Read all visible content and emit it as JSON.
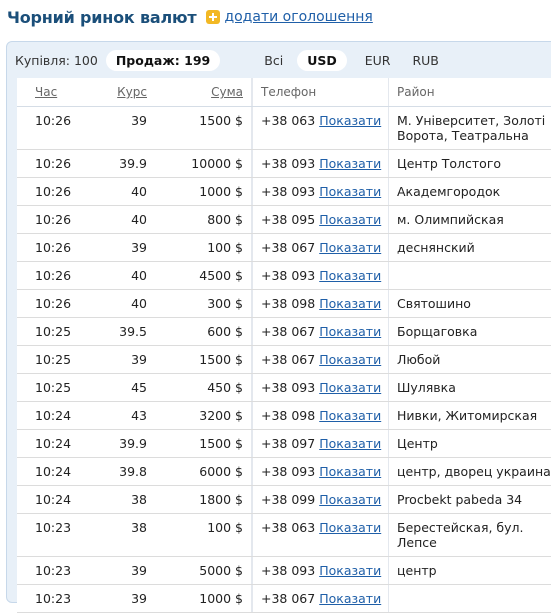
{
  "header": {
    "title": "Чорний ринок валют",
    "add_link": "додати оголошення"
  },
  "filters": {
    "buy_label": "Купівля: 100",
    "sell_label": "Продаж: 199",
    "currencies": [
      "Всі",
      "USD",
      "EUR",
      "RUB"
    ],
    "active_currency": "USD"
  },
  "table": {
    "columns": [
      "Час",
      "Курс",
      "Сума",
      "Телефон",
      "Район"
    ],
    "show_label": "Показати",
    "rows": [
      {
        "time": "10:26",
        "rate": "39",
        "amount": "1500 $",
        "phone": "+38 063",
        "district": "М. Університет, Золоті Ворота, Театральна"
      },
      {
        "time": "10:26",
        "rate": "39.9",
        "amount": "10000 $",
        "phone": "+38 093",
        "district": "Центр Толстого"
      },
      {
        "time": "10:26",
        "rate": "40",
        "amount": "1000 $",
        "phone": "+38 093",
        "district": "Академгородок"
      },
      {
        "time": "10:26",
        "rate": "40",
        "amount": "800 $",
        "phone": "+38 095",
        "district": "м. Олимпийская"
      },
      {
        "time": "10:26",
        "rate": "39",
        "amount": "100 $",
        "phone": "+38 067",
        "district": "деснянский"
      },
      {
        "time": "10:26",
        "rate": "40",
        "amount": "4500 $",
        "phone": "+38 093",
        "district": ""
      },
      {
        "time": "10:26",
        "rate": "40",
        "amount": "300 $",
        "phone": "+38 098",
        "district": "Святошино"
      },
      {
        "time": "10:25",
        "rate": "39.5",
        "amount": "600 $",
        "phone": "+38 067",
        "district": "Борщаговка"
      },
      {
        "time": "10:25",
        "rate": "39",
        "amount": "1500 $",
        "phone": "+38 067",
        "district": "Любой"
      },
      {
        "time": "10:25",
        "rate": "45",
        "amount": "450 $",
        "phone": "+38 093",
        "district": "Шулявка"
      },
      {
        "time": "10:24",
        "rate": "43",
        "amount": "3200 $",
        "phone": "+38 098",
        "district": "Нивки, Житомирская"
      },
      {
        "time": "10:24",
        "rate": "39.9",
        "amount": "1500 $",
        "phone": "+38 097",
        "district": "Центр"
      },
      {
        "time": "10:24",
        "rate": "39.8",
        "amount": "6000 $",
        "phone": "+38 093",
        "district": "центр, дворец украина"
      },
      {
        "time": "10:24",
        "rate": "38",
        "amount": "1800 $",
        "phone": "+38 099",
        "district": "Procbekt pabeda 34"
      },
      {
        "time": "10:23",
        "rate": "38",
        "amount": "100 $",
        "phone": "+38 063",
        "district": "Берестейская, бул. Лепсе"
      },
      {
        "time": "10:23",
        "rate": "39",
        "amount": "5000 $",
        "phone": "+38 093",
        "district": "центр"
      },
      {
        "time": "10:23",
        "rate": "39",
        "amount": "1000 $",
        "phone": "+38 067",
        "district": ""
      }
    ]
  }
}
